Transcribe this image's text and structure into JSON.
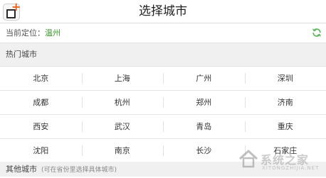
{
  "header": {
    "title": "选择城市"
  },
  "location": {
    "label": "当前定位：",
    "city": "温州"
  },
  "hot_section": {
    "title": "热门城市"
  },
  "hot_cities": [
    [
      "北京",
      "上海",
      "广州",
      "深圳"
    ],
    [
      "成都",
      "杭州",
      "郑州",
      "济南"
    ],
    [
      "西安",
      "武汉",
      "青岛",
      "重庆"
    ],
    [
      "沈阳",
      "南京",
      "长沙",
      "石家庄"
    ]
  ],
  "other_section": {
    "title": "其他城市",
    "hint": "(可在省份里选择具体城市)"
  },
  "watermark": {
    "text": "系统之家",
    "sub": "XITONGZHIJIA.NET"
  },
  "colors": {
    "location_city": "#3c9a2e",
    "refresh_icon": "#5cb85c",
    "accent_plus": "#e8671e"
  },
  "icons": {
    "app": "app-add-icon",
    "refresh": "refresh-icon",
    "watermark_logo": "house-logo-icon"
  }
}
